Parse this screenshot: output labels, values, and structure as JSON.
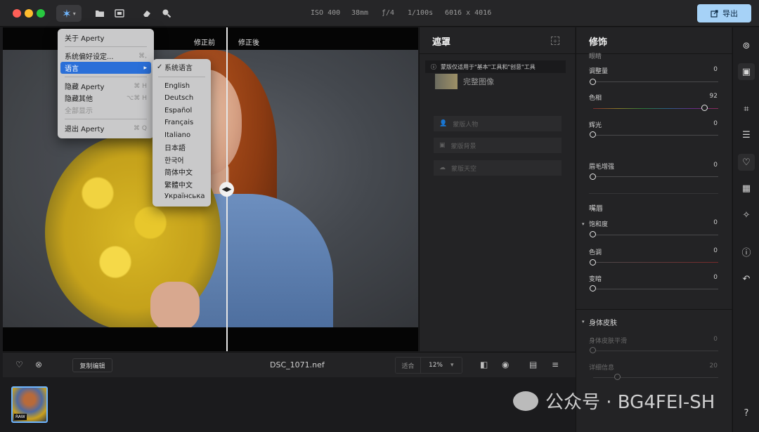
{
  "titlebar": {
    "meta": {
      "iso": "ISO 400",
      "focal": "38mm",
      "aperture": "ƒ/4",
      "shutter": "1/100s",
      "dimensions": "6016 x 4016"
    },
    "export_label": "导出"
  },
  "viewer": {
    "before_label": "修正前",
    "after_label": "修正後"
  },
  "app_menu": {
    "about": "关于 Aperty",
    "prefs": "系统偏好设定...",
    "prefs_sc": "⌘,",
    "language": "语言",
    "hide": "隐藏 Aperty",
    "hide_sc": "⌘ H",
    "hide_others": "隐藏其他",
    "hide_others_sc": "⌥⌘ H",
    "show_all": "全部显示",
    "quit": "退出 Aperty",
    "quit_sc": "⌘ Q"
  },
  "language_menu": {
    "system": "系统语言",
    "items": [
      "English",
      "Deutsch",
      "Español",
      "Français",
      "Italiano",
      "日本語",
      "한국어",
      "简体中文",
      "繁體中文",
      "Українська"
    ]
  },
  "mask_panel": {
    "title": "遮罩",
    "note": "蒙版仅适用于\"基本\"工具和\"创意\"工具",
    "full_image": "完整图像",
    "options": [
      "蒙版人物",
      "蒙版背景",
      "蒙版天空"
    ]
  },
  "retouch": {
    "title": "修饰",
    "partial_heading": "眼睛",
    "sliders_top": [
      {
        "label": "调整量",
        "value": "0",
        "pos": 0
      },
      {
        "label": "色相",
        "value": "92",
        "pos": 0.92
      },
      {
        "label": "辉光",
        "value": "0",
        "pos": 0
      },
      {
        "label": "眉毛增强",
        "value": "0",
        "pos": 0
      }
    ],
    "lips_heading": "嘴唇",
    "sliders_lips": [
      {
        "label": "饱和度",
        "value": "0",
        "pos": 0
      },
      {
        "label": "色调",
        "value": "0",
        "pos": 0
      },
      {
        "label": "变暗",
        "value": "0",
        "pos": 0
      }
    ],
    "body_heading": "身体皮肤",
    "sliders_body": [
      {
        "label": "身体皮肤平滑",
        "value": "0",
        "pos": 0
      },
      {
        "label": "详细信息",
        "value": "20",
        "pos": 0.2
      }
    ]
  },
  "bottombar": {
    "copy_edit": "复制编辑",
    "filename": "DSC_1071.nef",
    "fit": "适合",
    "zoom": "12%"
  },
  "filmstrip": {
    "raw": "RAW"
  },
  "watermark": "公众号 · BG4FEI-SH",
  "colors": {
    "accent": "#2a6fd8",
    "export": "#a6d2f7",
    "hue_slider_knob": "#e6e6e6"
  }
}
